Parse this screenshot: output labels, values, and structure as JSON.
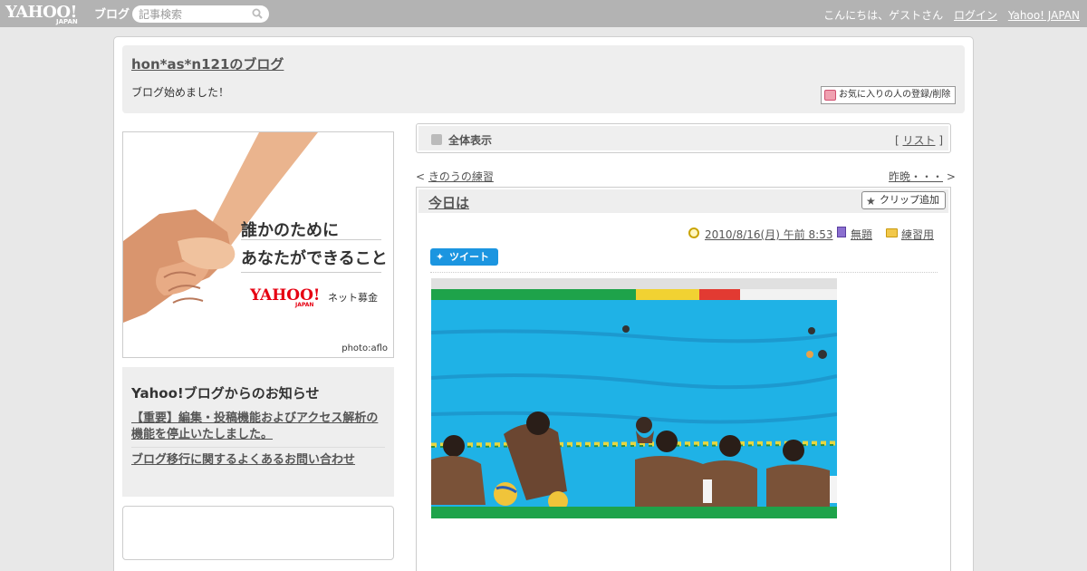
{
  "topbar": {
    "logo_yahoo": "YAHOO!",
    "logo_japan": "JAPAN",
    "logo_blog": "ブログ",
    "search_placeholder": "記事検索",
    "greeting": "こんにちは、ゲストさん",
    "login": "ログイン",
    "yahoo_japan": "Yahoo! JAPAN"
  },
  "header": {
    "blog_title": "hon*as*n121のブログ",
    "description": "ブログ始めました！",
    "fav_button": "お気に入りの人の登録/削除"
  },
  "ad": {
    "line1": "誰かのために",
    "line2": "あなたができること",
    "brand": "YAHOO!",
    "brand_sub": "JAPAN",
    "service": "ネット募金",
    "credit": "photo:aflo"
  },
  "notice": {
    "heading": "Yahoo!ブログからのお知らせ",
    "links": [
      "【重要】編集・投稿機能およびアクセス解析の機能を停止いたしました。",
      "ブログ移行に関するよくあるお問い合わせ"
    ]
  },
  "allview": {
    "label": "全体表示",
    "list_link": "リスト"
  },
  "nav": {
    "prev": "きのうの練習",
    "next": "昨晩・・・"
  },
  "article": {
    "title": "今日は",
    "clip_button": "クリップ追加",
    "datetime": "2010/8/16(月) 午前 8:53",
    "theme": "無題",
    "category": "練習用",
    "tweet": "ツイート"
  },
  "colors": {
    "topbar": "#b3b3b3",
    "tweet": "#1b95e0",
    "brand_red": "#e60012",
    "pool": "#1fb2e6"
  }
}
